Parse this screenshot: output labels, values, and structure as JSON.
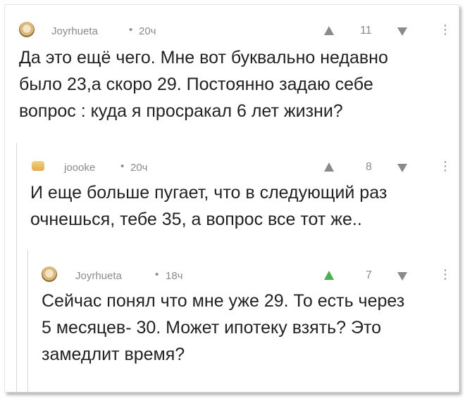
{
  "comments": [
    {
      "username": "Joyrhueta",
      "time": "20ч",
      "rating": "11",
      "text": "Да это ещё чего. Мне вот буквально недавно\nбыло 23,а скоро 29. Постоянно задаю себе\nвопрос : куда я просракал 6 лет жизни?",
      "avatar_icon": "owl-avatar-icon"
    },
    {
      "username": "joooke",
      "time": "20ч",
      "rating": "8",
      "text": "И еще больше пугает, что в следующий раз\nочнешься, тебе 35, а вопрос все тот же..",
      "avatar_icon": "pack-avatar-icon"
    },
    {
      "username": "Joyrhueta",
      "time": "18ч",
      "rating": "7",
      "text": "Сейчас понял что мне уже 29. То есть через\n5 месяцев- 30. Может ипотеку взять? Это\nзамедлит время?",
      "avatar_icon": "owl-avatar-icon"
    }
  ],
  "ui": {
    "separator": "•",
    "more_glyph": "⋮"
  },
  "colors": {
    "meta": "#8a8a8a",
    "upvote_active": "#4cae4c",
    "text": "#222222"
  }
}
